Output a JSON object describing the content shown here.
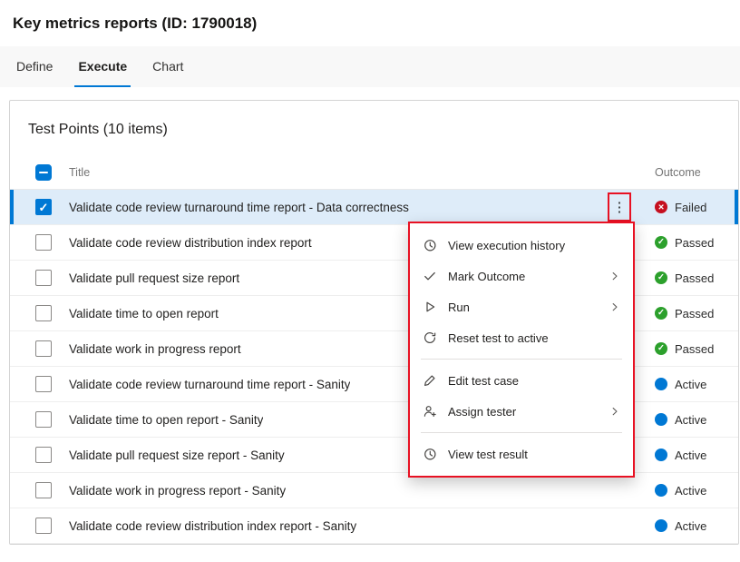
{
  "page": {
    "title": "Key metrics reports (ID: 1790018)"
  },
  "tabs": [
    {
      "label": "Define",
      "active": false
    },
    {
      "label": "Execute",
      "active": true
    },
    {
      "label": "Chart",
      "active": false
    }
  ],
  "panel": {
    "title": "Test Points (10 items)",
    "columns": {
      "title": "Title",
      "outcome": "Outcome"
    },
    "select_all_checkbox_state": "indeterminate"
  },
  "rows": [
    {
      "title": "Validate code review turnaround time report - Data correctness",
      "outcome": "Failed",
      "selected": true,
      "checked": true,
      "has_highlighted_more_button": true
    },
    {
      "title": "Validate code review distribution index report",
      "outcome": "Passed",
      "selected": false,
      "checked": false
    },
    {
      "title": "Validate pull request size report",
      "outcome": "Passed",
      "selected": false,
      "checked": false
    },
    {
      "title": "Validate time to open report",
      "outcome": "Passed",
      "selected": false,
      "checked": false
    },
    {
      "title": "Validate work in progress report",
      "outcome": "Passed",
      "selected": false,
      "checked": false
    },
    {
      "title": "Validate code review turnaround time report - Sanity",
      "outcome": "Active",
      "selected": false,
      "checked": false
    },
    {
      "title": "Validate time to open report - Sanity",
      "outcome": "Active",
      "selected": false,
      "checked": false
    },
    {
      "title": "Validate pull request size report - Sanity",
      "outcome": "Active",
      "selected": false,
      "checked": false
    },
    {
      "title": "Validate work in progress report - Sanity",
      "outcome": "Active",
      "selected": false,
      "checked": false
    },
    {
      "title": "Validate code review distribution index report - Sanity",
      "outcome": "Active",
      "selected": false,
      "checked": false
    }
  ],
  "context_menu": {
    "items": [
      {
        "type": "item",
        "label": "View execution history",
        "icon": "history-icon",
        "has_submenu": false
      },
      {
        "type": "item",
        "label": "Mark Outcome",
        "icon": "check-icon",
        "has_submenu": true
      },
      {
        "type": "item",
        "label": "Run",
        "icon": "play-icon",
        "has_submenu": true
      },
      {
        "type": "item",
        "label": "Reset test to active",
        "icon": "reset-icon",
        "has_submenu": false
      },
      {
        "type": "divider"
      },
      {
        "type": "item",
        "label": "Edit test case",
        "icon": "edit-icon",
        "has_submenu": false
      },
      {
        "type": "item",
        "label": "Assign tester",
        "icon": "assign-tester-icon",
        "has_submenu": true
      },
      {
        "type": "divider"
      },
      {
        "type": "item",
        "label": "View test result",
        "icon": "history-icon",
        "has_submenu": false
      }
    ]
  },
  "colors": {
    "accent": "#0078d4",
    "failed": "#c50f1f",
    "passed": "#2ca02c",
    "active": "#0078d4",
    "selected_row_background": "#deecf9",
    "highlight_border": "#e81123"
  }
}
